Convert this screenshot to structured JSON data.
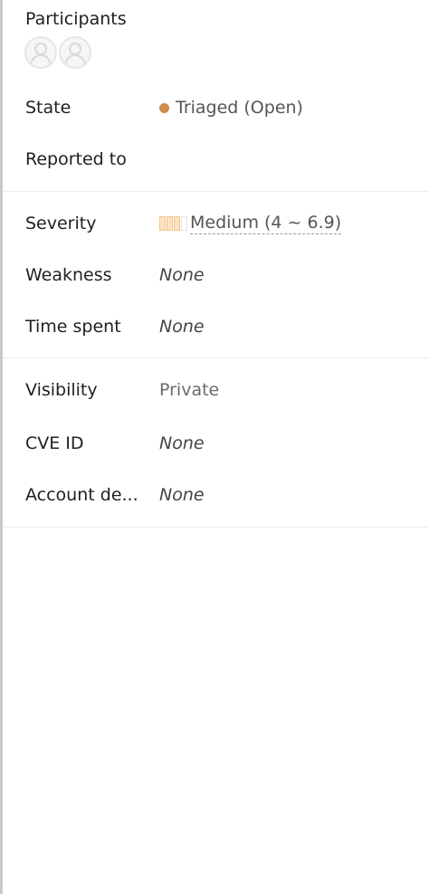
{
  "participants": {
    "title": "Participants",
    "avatars": [
      {
        "icon": "user-avatar-icon"
      },
      {
        "icon": "user-avatar-icon"
      }
    ]
  },
  "rows": {
    "state": {
      "label": "State",
      "value": "Triaged (Open)",
      "dot_color": "#d08a4a"
    },
    "reported_to": {
      "label": "Reported to",
      "value": ""
    },
    "severity": {
      "label": "Severity",
      "value": "Medium (4 ~ 6.9)",
      "meter_level": 3,
      "meter_total": 4,
      "meter_color": "#f3c48a"
    },
    "weakness": {
      "label": "Weakness",
      "value": "None"
    },
    "time_spent": {
      "label": "Time spent",
      "value": "None"
    },
    "visibility": {
      "label": "Visibility",
      "value": "Private"
    },
    "cve_id": {
      "label": "CVE ID",
      "value": "None"
    },
    "account_details": {
      "label": "Account de...",
      "value": "None"
    }
  }
}
